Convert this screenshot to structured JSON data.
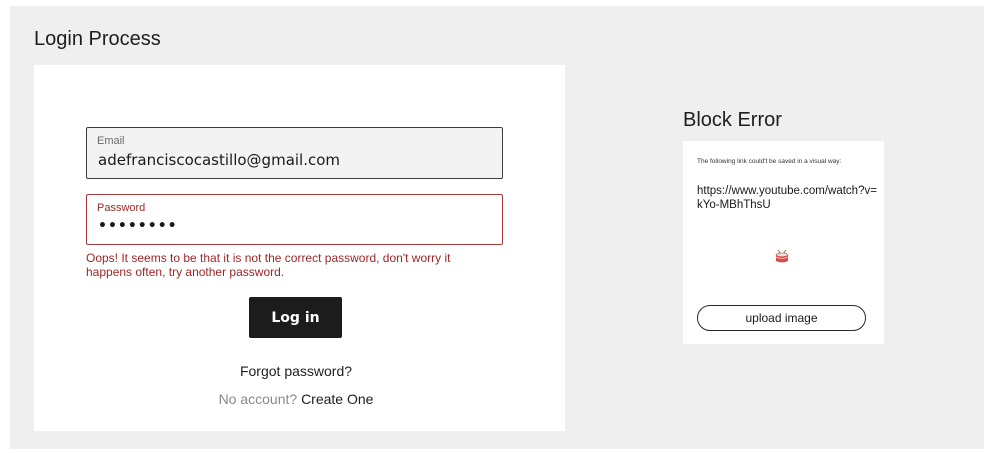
{
  "login": {
    "title": "Login Process",
    "email_label": "Email",
    "email_value": "adefranciscocastillo@gmail.com",
    "password_label": "Password",
    "password_value": "••••••••",
    "error_message": "Oops! It seems to be that it is not the correct password, don't worry it happens often, try another password.",
    "login_button": "Log in",
    "forgot_password": "Forgot password?",
    "no_account": "No account?",
    "create_one": "Create One"
  },
  "block_error": {
    "title": "Block Error",
    "description": "The following link could't be saved in a visual way:",
    "url": "https://www.youtube.com/watch?v=kYo-MBhThsU",
    "icon": "drum-icon",
    "upload_button": "upload image"
  },
  "colors": {
    "background": "#efefef",
    "card": "#ffffff",
    "error": "#9c2626",
    "button": "#1c1c1c"
  }
}
